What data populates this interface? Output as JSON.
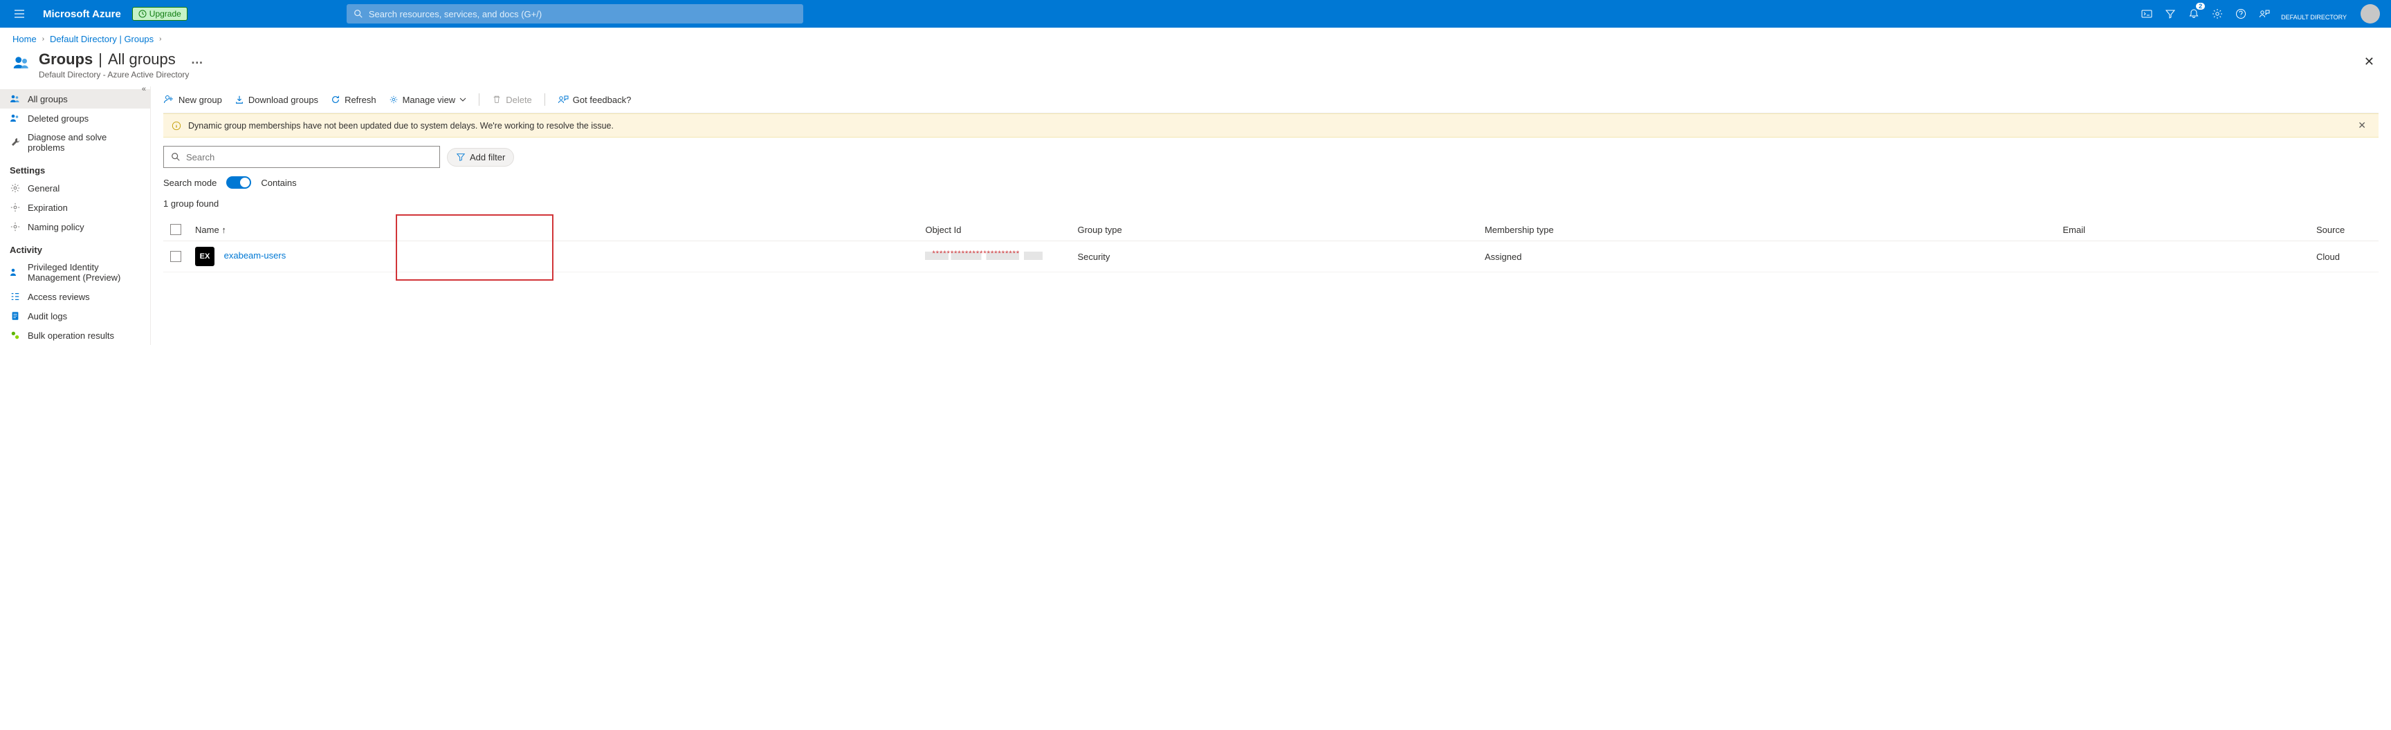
{
  "topbar": {
    "brand": "Microsoft Azure",
    "upgrade_label": "Upgrade",
    "search_placeholder": "Search resources, services, and docs (G+/)",
    "notification_count": "2",
    "account_email": "",
    "account_tenant": "DEFAULT DIRECTORY"
  },
  "breadcrumb": {
    "items": [
      "Home",
      "Default Directory | Groups"
    ],
    "chevron": "›"
  },
  "page": {
    "title_strong": "Groups",
    "title_sep": " | ",
    "title_light": "All groups",
    "subtitle": "Default Directory - Azure Active Directory"
  },
  "leftnav": {
    "items": [
      {
        "label": "All groups",
        "active": true,
        "icon": "people-icon"
      },
      {
        "label": "Deleted groups",
        "active": false,
        "icon": "people-icon"
      },
      {
        "label": "Diagnose and solve problems",
        "active": false,
        "icon": "wrench-icon"
      }
    ],
    "heading_settings": "Settings",
    "settings_items": [
      {
        "label": "General",
        "icon": "gear-icon"
      },
      {
        "label": "Expiration",
        "icon": "gear-icon"
      },
      {
        "label": "Naming policy",
        "icon": "gear-icon"
      }
    ],
    "heading_activity": "Activity",
    "activity_items": [
      {
        "label": "Privileged Identity Management (Preview)",
        "icon": "people-icon"
      },
      {
        "label": "Access reviews",
        "icon": "checklist-icon"
      },
      {
        "label": "Audit logs",
        "icon": "document-icon"
      },
      {
        "label": "Bulk operation results",
        "icon": "gears-icon"
      }
    ]
  },
  "toolbar": {
    "new_group": "New group",
    "download": "Download groups",
    "refresh": "Refresh",
    "manage_view": "Manage view",
    "delete": "Delete",
    "feedback": "Got feedback?"
  },
  "warning": {
    "text": "Dynamic group memberships have not been updated due to system delays. We're working to resolve the issue."
  },
  "search": {
    "placeholder": "Search",
    "add_filter": "Add filter",
    "mode_label": "Search mode",
    "mode_value": "Contains"
  },
  "results": {
    "count_text": "1 group found",
    "columns": {
      "name": "Name",
      "name_sort": "↑",
      "object_id": "Object Id",
      "group_type": "Group type",
      "membership_type": "Membership type",
      "email": "Email",
      "source": "Source"
    },
    "rows": [
      {
        "initials": "EX",
        "name": "exabeam-users",
        "object_id": "************************",
        "group_type": "Security",
        "membership_type": "Assigned",
        "email": "",
        "source": "Cloud"
      }
    ]
  },
  "colors": {
    "azure_blue": "#0078d4",
    "highlight_red": "#d13438"
  }
}
